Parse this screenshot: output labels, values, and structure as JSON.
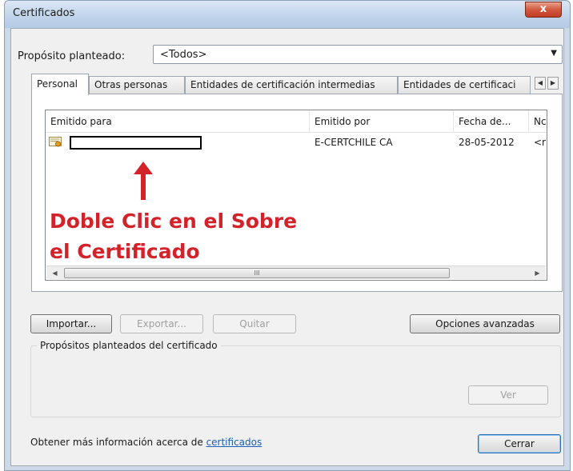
{
  "window": {
    "title": "Certificados",
    "close_label": "x"
  },
  "purpose": {
    "label": "Propósito planteado:",
    "selected": "<Todos>"
  },
  "tabs": [
    {
      "label": "Personal"
    },
    {
      "label": "Otras personas"
    },
    {
      "label": "Entidades de certificación intermedias"
    },
    {
      "label": "Entidades de certificaci"
    }
  ],
  "tab_scroll": {
    "left": "◀",
    "right": "▶"
  },
  "list": {
    "columns": [
      "Emitido para",
      "Emitido por",
      "Fecha de...",
      "Nc"
    ],
    "rows": [
      {
        "issued_to": "",
        "issued_by": "E-CERTCHILE CA",
        "date": "28-05-2012",
        "extra": "<r"
      }
    ],
    "scroll_left": "◀",
    "scroll_right": "▶",
    "scroll_thumb": "III"
  },
  "annotation": {
    "line1": "Doble Clic en el Sobre",
    "line2": "el Certificado",
    "color": "#d2222a"
  },
  "buttons": {
    "import": "Importar...",
    "export": "Exportar...",
    "remove": "Quitar",
    "advanced": "Opciones avanzadas",
    "view": "Ver",
    "close": "Cerrar"
  },
  "purposes_group": {
    "label": "Propósitos planteados del certificado"
  },
  "footer": {
    "text": "Obtener más información acerca de",
    "link": "certificados"
  }
}
